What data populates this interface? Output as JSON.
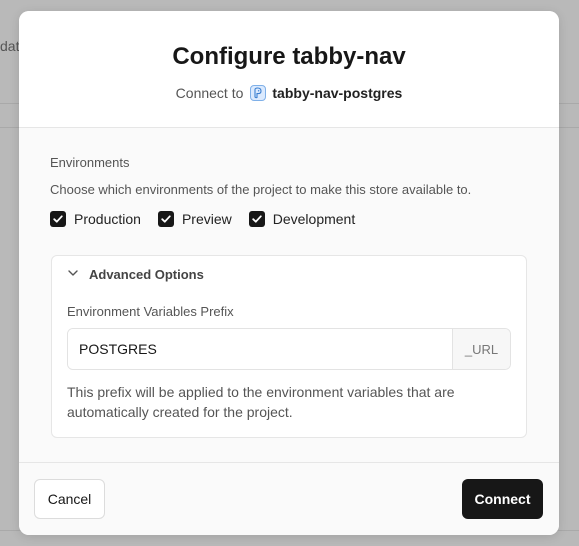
{
  "background": {
    "fragment_text": "data"
  },
  "modal": {
    "title": "Configure tabby-nav",
    "connect_prefix": "Connect to",
    "store_name": "tabby-nav-postgres",
    "store_icon": "postgres-database-icon"
  },
  "environments": {
    "label": "Environments",
    "description": "Choose which environments of the project to make this store available to.",
    "options": [
      {
        "label": "Production",
        "checked": true
      },
      {
        "label": "Preview",
        "checked": true
      },
      {
        "label": "Development",
        "checked": true
      }
    ]
  },
  "advanced": {
    "title": "Advanced Options",
    "expanded": true,
    "prefix_label": "Environment Variables Prefix",
    "prefix_value": "POSTGRES",
    "suffix": "_URL",
    "help_text": "This prefix will be applied to the environment variables that are automatically created for the project."
  },
  "footer": {
    "cancel_label": "Cancel",
    "connect_label": "Connect"
  },
  "colors": {
    "primary_button": "#171717",
    "overlay": "#b9b9b9",
    "modal_body": "#fafafa"
  }
}
